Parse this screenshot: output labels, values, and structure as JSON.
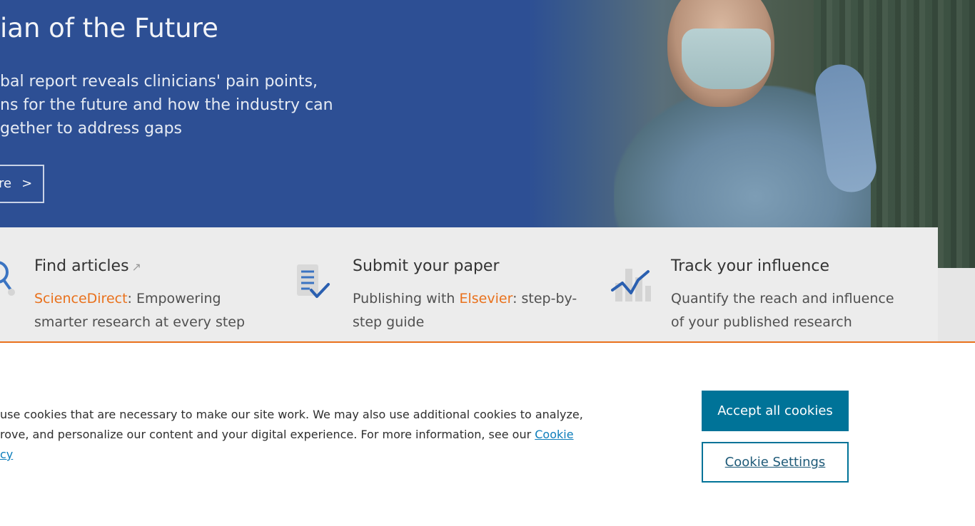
{
  "hero": {
    "title": "ian of the Future",
    "description_lines": [
      "bal report reveals clinicians' pain points,",
      "ns for the future and how the industry can",
      "gether to address gaps"
    ],
    "button_label": "re",
    "button_arrow": ">",
    "background_color": "#2d4f94"
  },
  "features": [
    {
      "title": "Find articles",
      "title_suffix": "↗",
      "link_text": "ScienceDirect",
      "desc_line1_rest": ": Empowering",
      "desc_line2": "smarter research at every step",
      "icon": "search-icon"
    },
    {
      "title": "Submit your paper",
      "desc_prefix": "Publishing with ",
      "link_text": "Elsevier",
      "desc_line1_rest": ": step-by-",
      "desc_line2": "step guide",
      "icon": "document-check-icon"
    },
    {
      "title": "Track your influence",
      "desc_line1": "Quantify the reach and influence",
      "desc_line2": "of your published research",
      "icon": "chart-trend-icon"
    }
  ],
  "cookie_banner": {
    "lines": [
      "use cookies that are necessary to make our site work. We may also use additional cookies to analyze,",
      "rove, and personalize our content and your digital experience. For more information, see our ",
      "cy"
    ],
    "link_text_1": "Cookie",
    "accept_label": "Accept all cookies",
    "settings_label": "Cookie Settings",
    "accent_color": "#e9711c",
    "button_color": "#007398"
  }
}
